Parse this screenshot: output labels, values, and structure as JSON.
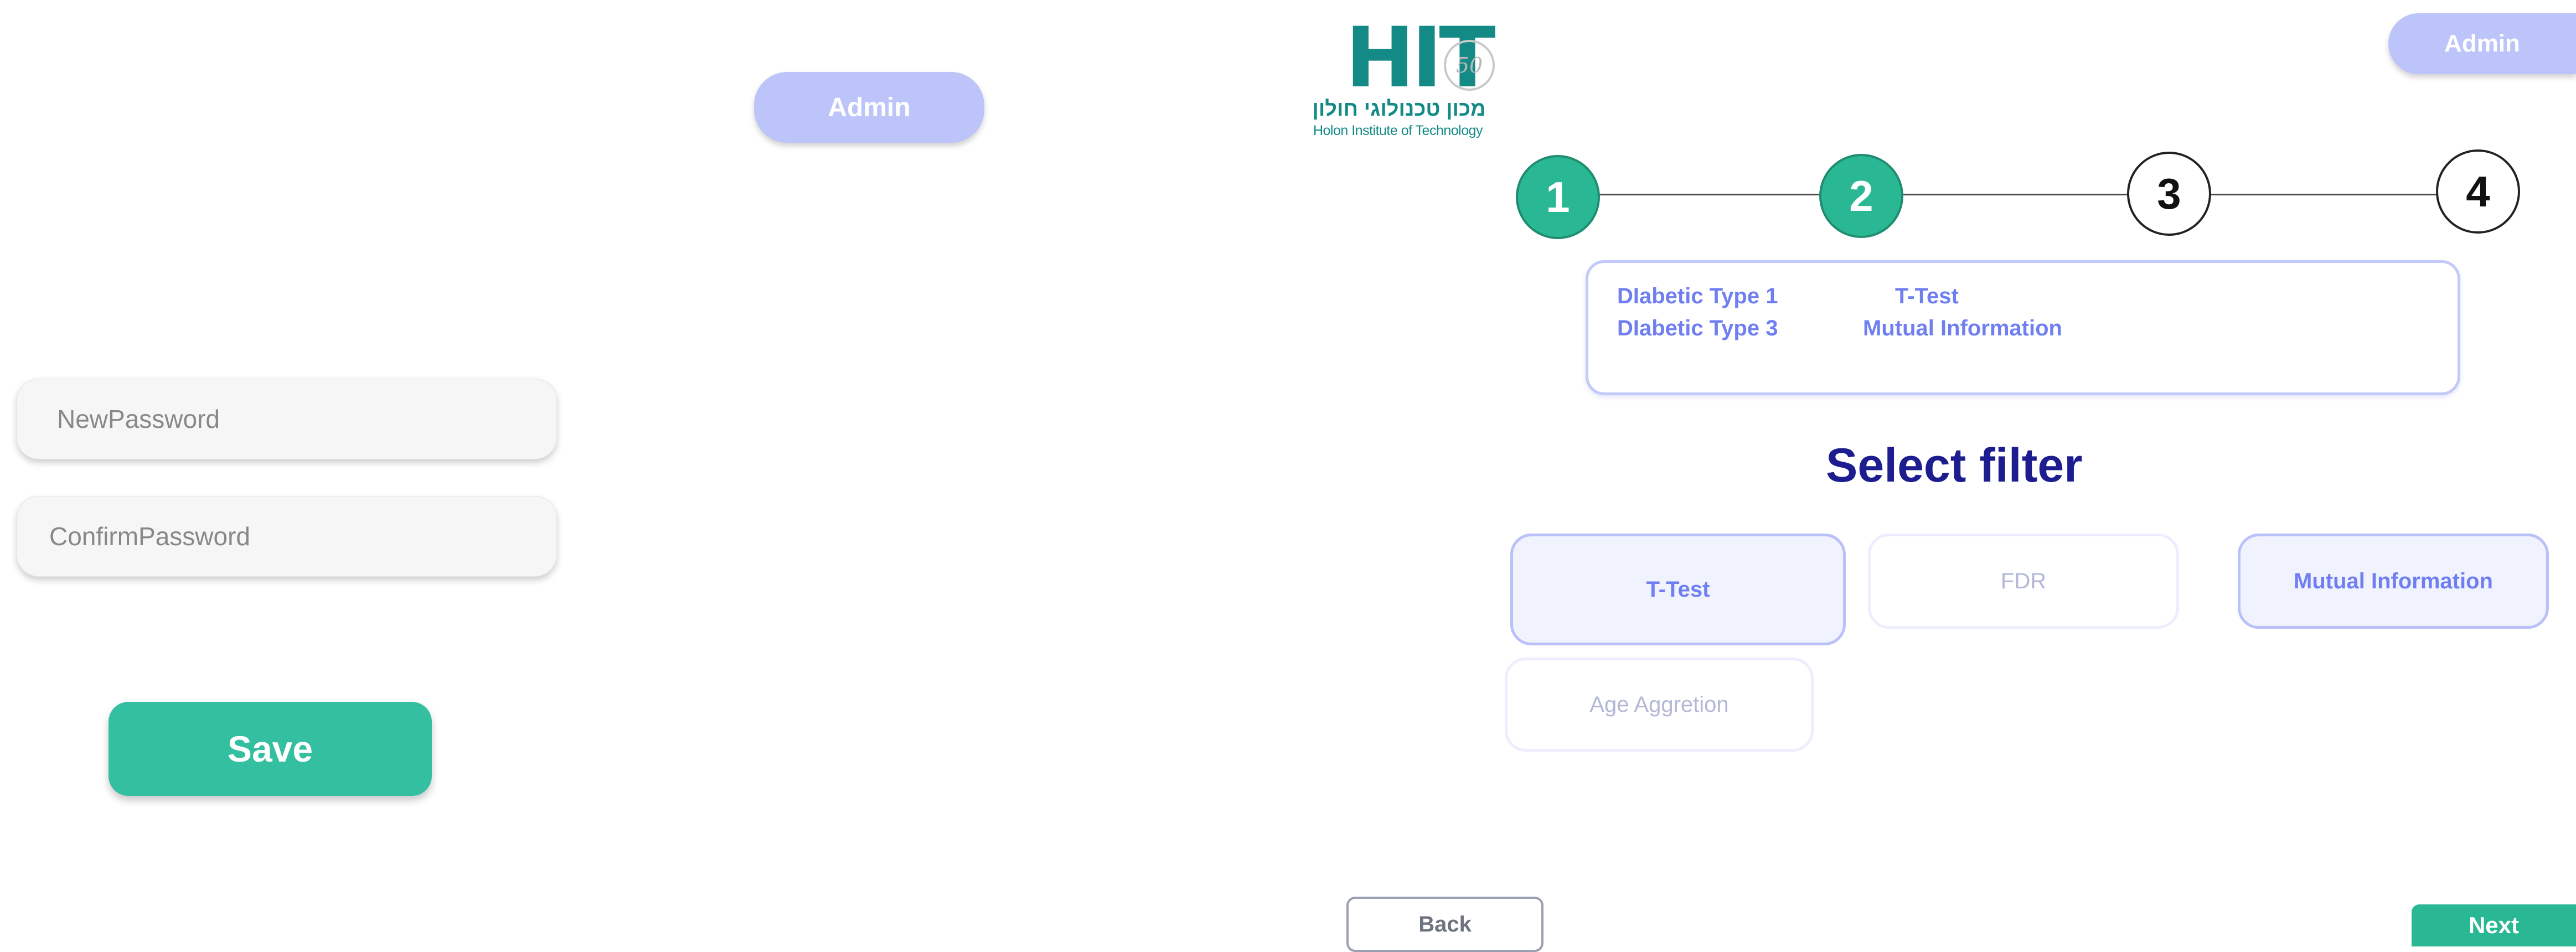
{
  "left_panel": {
    "admin_label": "Admin",
    "new_password_placeholder": "NewPassword",
    "confirm_password_placeholder": "ConfirmPassword",
    "save_label": "Save"
  },
  "logo": {
    "main_text": "HIT",
    "badge_text": "50",
    "hebrew_text": "מכון טכנולוגי חולון",
    "english_text": "Holon Institute of Technology"
  },
  "right_panel": {
    "admin_label": "Admin",
    "steps": [
      {
        "number": "1",
        "state": "done"
      },
      {
        "number": "2",
        "state": "done"
      },
      {
        "number": "3",
        "state": "todo"
      },
      {
        "number": "4",
        "state": "todo"
      }
    ],
    "summary": {
      "row1_dataset": "DIabetic Type 1",
      "row1_filter": "T-Test",
      "row2_dataset": "DIabetic Type 3",
      "row2_filter": "Mutual Information"
    },
    "heading": "Select filter",
    "filters": [
      {
        "label": "T-Test",
        "selected": true
      },
      {
        "label": "FDR",
        "selected": false
      },
      {
        "label": "Mutual Information",
        "selected": true
      },
      {
        "label": "Age Aggretion",
        "selected": false
      }
    ],
    "back_label": "Back",
    "next_label": "Next"
  },
  "colors": {
    "accent_green": "#33bfa0",
    "admin_pill": "#bcc4f9",
    "heading_navy": "#1d1d8f",
    "summary_text": "#6f7ff2",
    "logo_teal": "#138a86"
  }
}
